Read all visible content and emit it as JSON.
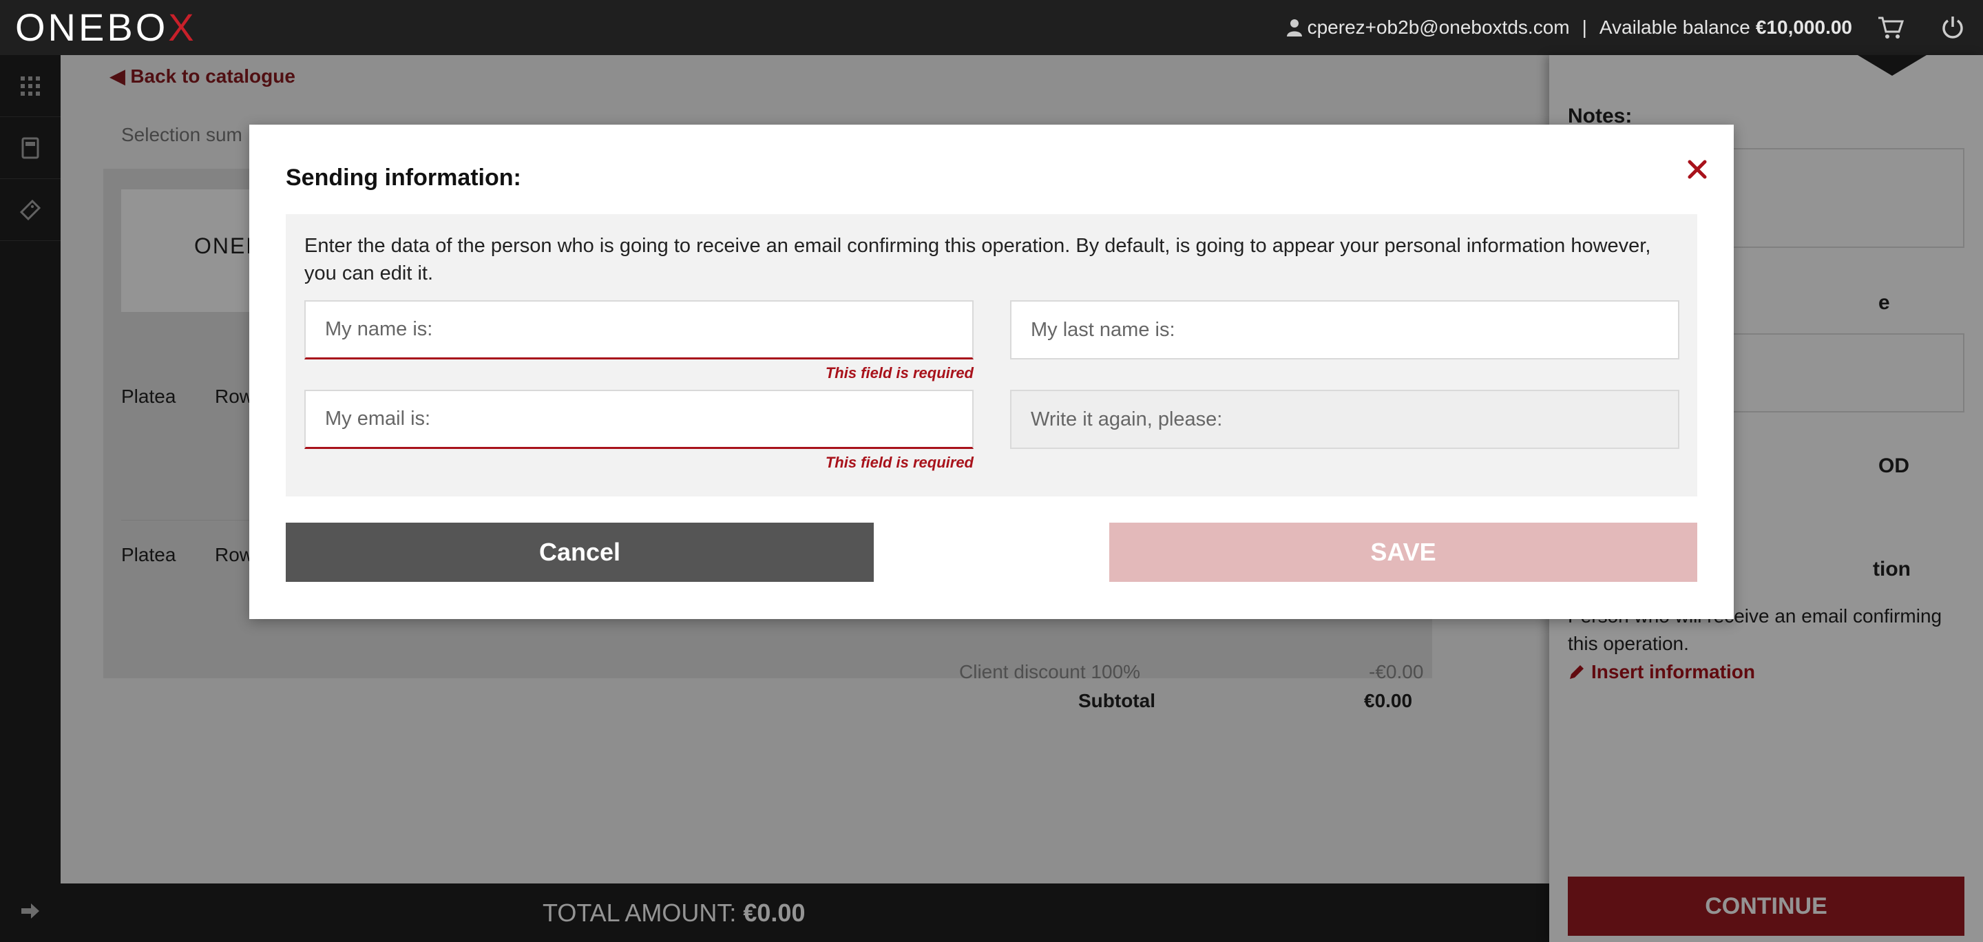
{
  "header": {
    "logo_text": "ONEBO",
    "logo_accent": "X",
    "user_email": "cperez+ob2b@oneboxtds.com",
    "separator": "|",
    "balance_label": "Available balance",
    "balance_value": "€10,000.00"
  },
  "nav": {
    "items": [
      "apps-icon",
      "calculator-icon",
      "ticket-icon"
    ],
    "bottom": "arrow-right-icon"
  },
  "main": {
    "back_label": "Back to catalogue",
    "selection_summary": "Selection sum",
    "logo_card_text": "ONEB",
    "rows": [
      {
        "zone": "Platea",
        "row": "Row"
      },
      {
        "zone": "Platea",
        "row": "Row"
      }
    ],
    "discount_label": "Client discount 100%",
    "discount_value": "-€0.00",
    "subtotal_label": "Subtotal",
    "subtotal_value": "€0.00",
    "total_label": "TOTAL AMOUNT:",
    "total_value": "€0.00"
  },
  "right_panel": {
    "notes_label": "Notes:",
    "partial_e": "e",
    "partial_od": "OD",
    "partial_tion": "tion",
    "description": "Person who will receive an email confirming this operation.",
    "insert_label": "Insert information",
    "continue_label": "CONTINUE"
  },
  "modal": {
    "title": "Sending information:",
    "intro": "Enter the data of the person who is going to receive an email confirming this operation. By default, is going to appear your personal information however, you can edit it.",
    "fields": {
      "name_placeholder": "My name is:",
      "lastname_placeholder": "My last name is:",
      "email_placeholder": "My email is:",
      "email_repeat_placeholder": "Write it again, please:"
    },
    "error_message": "This field is required",
    "cancel_label": "Cancel",
    "save_label": "SAVE"
  },
  "colors": {
    "accent": "#a8121b",
    "dark": "#1f1f1f",
    "save_disabled": "#e3b9ba",
    "cancel": "#555555"
  }
}
